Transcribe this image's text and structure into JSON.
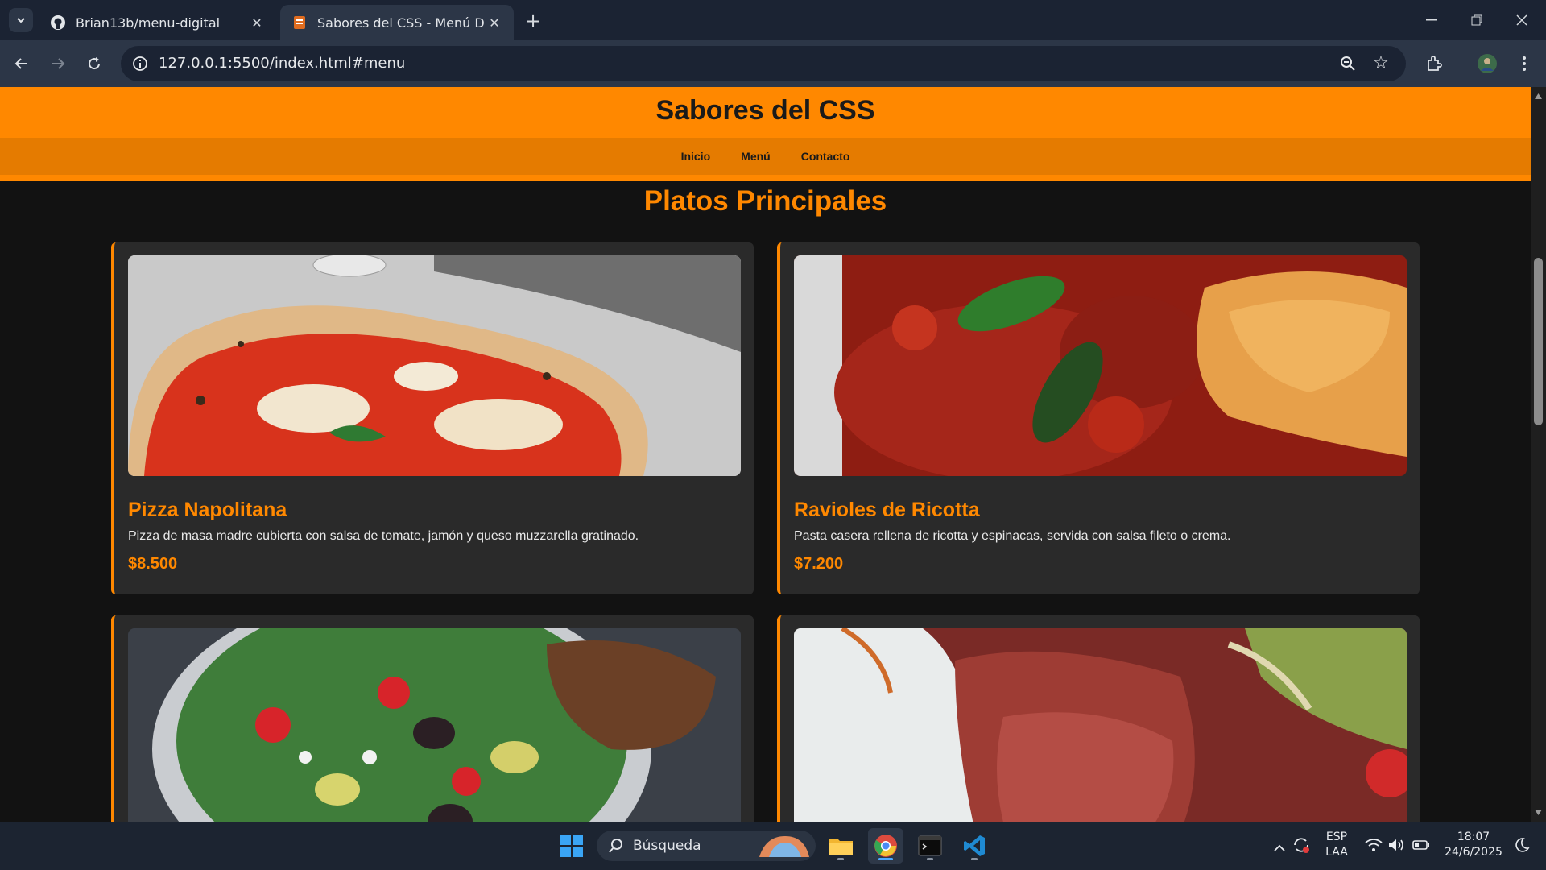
{
  "browser": {
    "tabs": [
      {
        "title": "Brian13b/menu-digital",
        "active": false,
        "icon": "github-icon"
      },
      {
        "title": "Sabores del CSS - Menú Digital",
        "active": true,
        "icon": "html-file-icon"
      }
    ],
    "url": "127.0.0.1:5500/index.html#menu"
  },
  "site": {
    "title": "Sabores del CSS",
    "nav": [
      "Inicio",
      "Menú",
      "Contacto"
    ],
    "accent_color": "#ff8800",
    "section_title": "Platos Principales",
    "dishes": [
      {
        "name": "Pizza Napolitana",
        "description": "Pizza de masa madre cubierta con salsa de tomate, jamón y queso muzzarella gratinado.",
        "price": "$8.500",
        "image": "pizza-photo"
      },
      {
        "name": "Ravioles de Ricotta",
        "description": "Pasta casera rellena de ricotta y espinacas, servida con salsa fileto o crema.",
        "price": "$7.200",
        "image": "ravioli-photo"
      },
      {
        "name": "",
        "description": "",
        "price": "",
        "image": "salad-photo"
      },
      {
        "name": "",
        "description": "",
        "price": "",
        "image": "roast-beef-photo"
      }
    ]
  },
  "taskbar": {
    "search_placeholder": "Búsqueda",
    "language": "ESP",
    "layout": "LAA",
    "time": "18:07",
    "date": "24/6/2025"
  }
}
